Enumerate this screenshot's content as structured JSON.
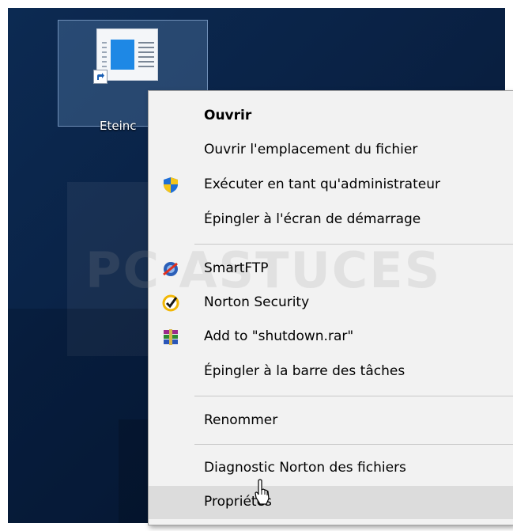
{
  "desktop": {
    "icon_label": "Eteinc"
  },
  "context_menu": {
    "items": [
      {
        "label": "Ouvrir",
        "bold": true
      },
      {
        "label": "Ouvrir l'emplacement du fichier"
      },
      {
        "label": "Exécuter en tant qu'administrateur",
        "icon": "uac-shield-icon"
      },
      {
        "label": "Épingler à l'écran de démarrage"
      },
      {
        "label": "SmartFTP",
        "icon": "smartftp-icon"
      },
      {
        "label": "Norton Security",
        "icon": "norton-check-icon"
      },
      {
        "label": "Add to \"shutdown.rar\"",
        "icon": "winrar-icon"
      },
      {
        "label": "Épingler à la barre des tâches"
      },
      {
        "label": "Renommer"
      },
      {
        "label": "Diagnostic Norton des fichiers"
      },
      {
        "label": "Propriétés",
        "hovered": true
      }
    ]
  },
  "watermark": {
    "text": "PC ASTUCES"
  },
  "colors": {
    "desktop_bg": "#0a2347",
    "menu_bg": "#f2f2f2",
    "hover_bg": "#dcdcdc",
    "icon_selection": "#78a0d2"
  }
}
